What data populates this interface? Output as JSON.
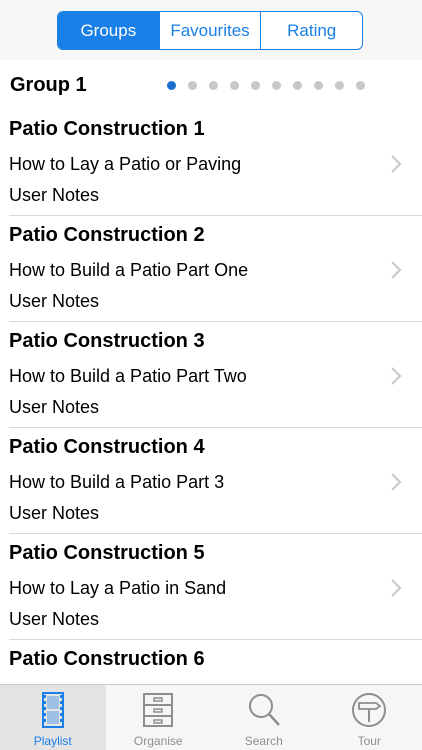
{
  "segments": [
    {
      "label": "Groups",
      "active": true
    },
    {
      "label": "Favourites",
      "active": false
    },
    {
      "label": "Rating",
      "active": false
    }
  ],
  "group": {
    "title": "Group 1",
    "page_count": 10,
    "current_page": 1
  },
  "rows": [
    {
      "title": "Patio Construction 1",
      "subtitle": "How to Lay a Patio or Paving",
      "notes": "User Notes"
    },
    {
      "title": "Patio Construction 2",
      "subtitle": "How to Build a Patio Part One",
      "notes": "User Notes"
    },
    {
      "title": "Patio Construction 3",
      "subtitle": "How to Build a Patio Part Two",
      "notes": "User Notes"
    },
    {
      "title": "Patio Construction 4",
      "subtitle": "How to Build a Patio Part 3",
      "notes": "User Notes"
    },
    {
      "title": "Patio Construction 5",
      "subtitle": "How to Lay a Patio in Sand",
      "notes": "User Notes"
    },
    {
      "title": "Patio Construction 6",
      "subtitle": "",
      "notes": ""
    }
  ],
  "tabs": [
    {
      "label": "Playlist",
      "icon": "film-strip-icon",
      "active": true
    },
    {
      "label": "Organise",
      "icon": "cabinet-icon",
      "active": false
    },
    {
      "label": "Search",
      "icon": "magnifier-icon",
      "active": false
    },
    {
      "label": "Tour",
      "icon": "signpost-icon",
      "active": false
    }
  ],
  "colors": {
    "accent": "#1a7fe6",
    "inactive_tab": "#8e8e8e"
  }
}
